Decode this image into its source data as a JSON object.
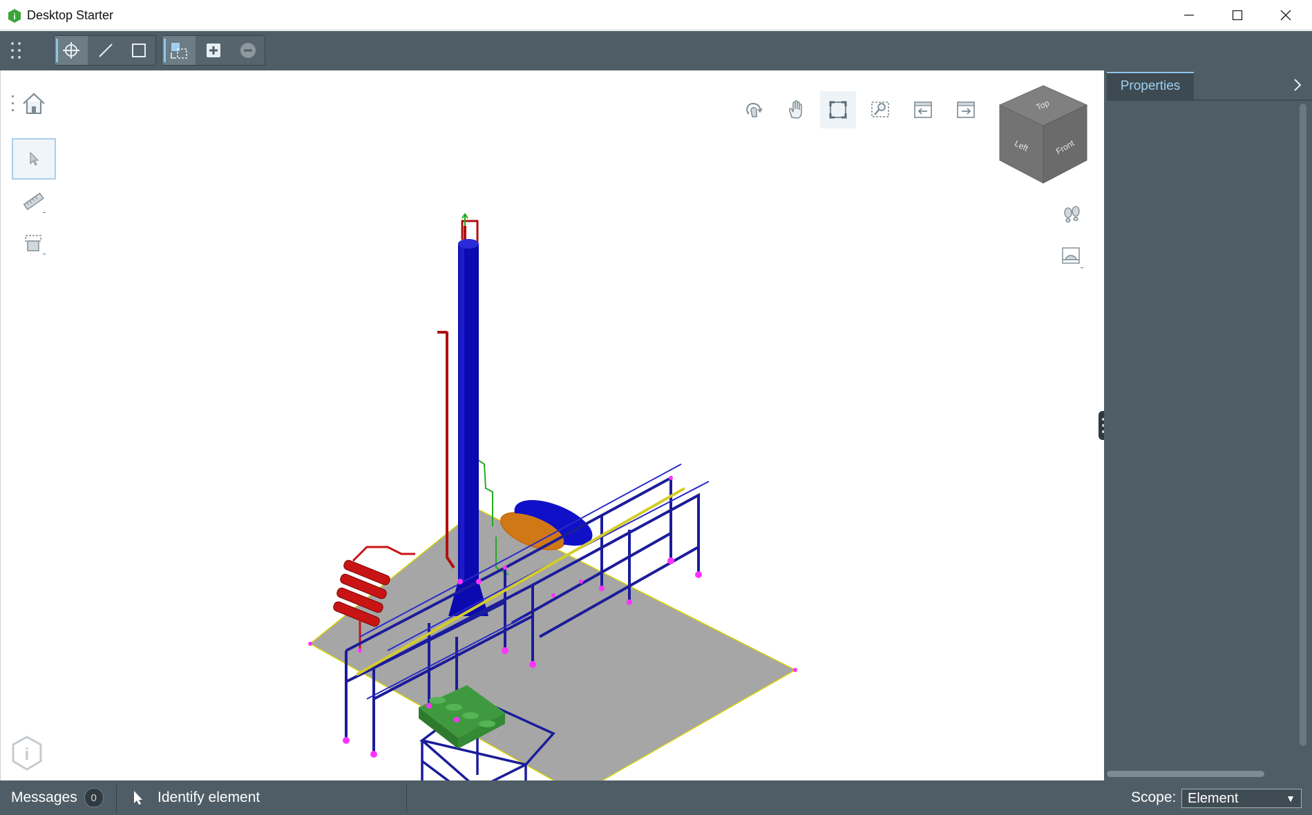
{
  "window": {
    "title": "Desktop Starter"
  },
  "toolbar": {
    "groups": [
      {
        "items": [
          {
            "icon": "snap-crosshair-icon",
            "active": true
          },
          {
            "icon": "line-tool-icon"
          },
          {
            "icon": "rectangle-tool-icon"
          }
        ]
      },
      {
        "items": [
          {
            "icon": "select-window-icon",
            "active": true
          },
          {
            "icon": "add-icon"
          },
          {
            "icon": "remove-icon"
          }
        ]
      }
    ]
  },
  "viewport": {
    "left_tools": [
      "home-icon",
      "select-arrow-icon",
      "measure-ruler-icon",
      "section-clip-icon"
    ],
    "view_tools": [
      "rotate-icon",
      "pan-hand-icon",
      "fit-view-icon",
      "zoom-window-icon",
      "previous-view-icon",
      "next-view-icon"
    ],
    "right_tools": [
      "walk-footprints-icon",
      "camera-icon"
    ],
    "view_cube": {
      "top": "Top",
      "left": "Left",
      "front": "Front"
    }
  },
  "panel": {
    "tab_label": "Properties"
  },
  "status": {
    "messages_label": "Messages",
    "messages_count": "0",
    "prompt": "Identify element",
    "scope_label": "Scope:",
    "scope_value": "Element"
  },
  "colors": {
    "toolbar_bg": "#4f5e66",
    "accent": "#8fc4e8",
    "structure": "#1c1ca8",
    "piping_red": "#c01010",
    "vessel_orange": "#d07012",
    "equipment_green": "#3f9a3f",
    "ground": "#a6a6a6"
  }
}
